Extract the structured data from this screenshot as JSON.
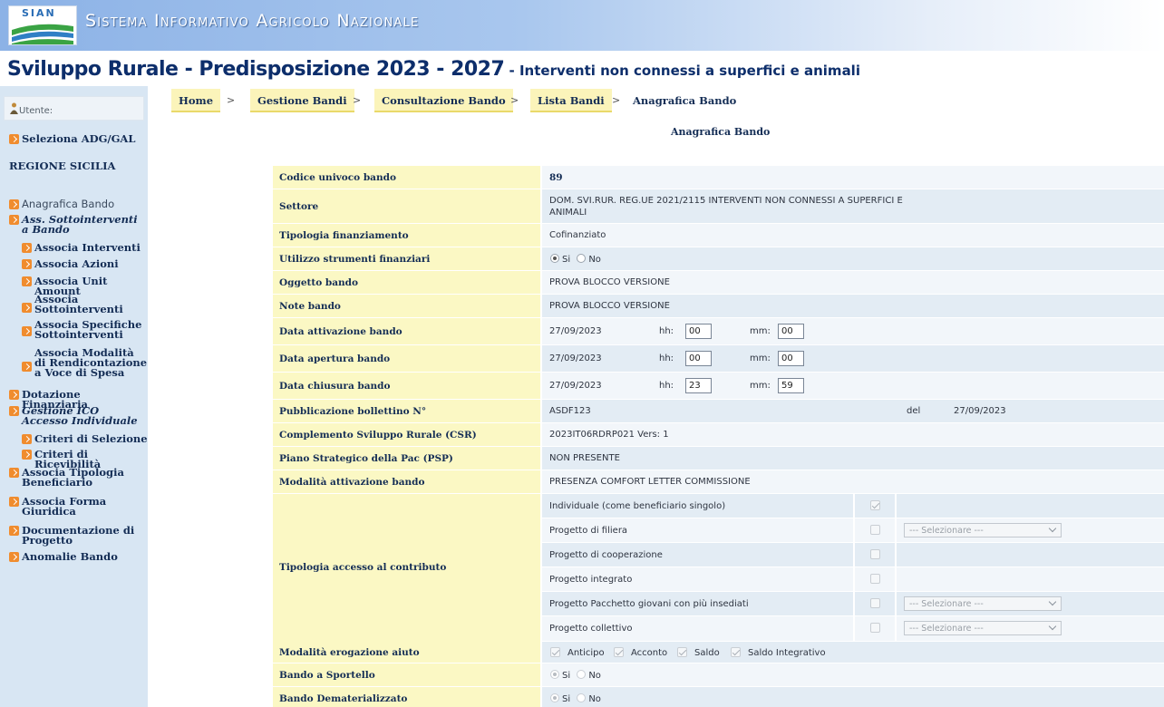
{
  "banner": {
    "logo_text": "SIAN",
    "title": "Sistema Informativo Agricolo Nazionale"
  },
  "page_title": {
    "main": "Sviluppo Rurale - Predisposizione 2023 - 2027",
    "sub": " - Interventi non connessi a superfici e animali"
  },
  "sidebar": {
    "utente_label": "Utente:",
    "seleziona": "Seleziona ADG/GAL",
    "regione": "REGIONE SICILIA",
    "items": [
      "Anagrafica Bando",
      "Ass. Sottointerventi a Bando",
      "Associa Interventi",
      "Associa Azioni",
      "Associa Unit Amount",
      "Associa Sottointerventi",
      "Associa Specifiche Sottointerventi",
      "Associa Modalità di Rendicontazione a Voce di Spesa",
      "Dotazione Finanziaria",
      "Gestione ICO Accesso Individuale",
      "Criteri di Selezione",
      "Criteri di Ricevibilità",
      "Associa Tipologia Beneficiario",
      "Associa Forma Giuridica",
      "Documentazione di Progetto",
      "Anomalie Bando"
    ]
  },
  "breadcrumb": {
    "home": "Home",
    "gestione": "Gestione Bandi",
    "consultazione": "Consultazione Bando",
    "lista": "Lista Bandi",
    "current": "Anagrafica Bando",
    "sep": ">"
  },
  "section_title": "Anagrafica Bando",
  "form": {
    "codice_label": "Codice univoco bando",
    "codice_value": "89",
    "settore_label": "Settore",
    "settore_value_1": "DOM. SVI.RUR. REG.UE 2021/2115 INTERVENTI NON CONNESSI A SUPERFICI E",
    "settore_value_2": "ANIMALI",
    "tipologia_fin_label": "Tipologia finanziamento",
    "tipologia_fin_value": "Cofinanziato",
    "utilizzo_label": "Utilizzo strumenti finanziari",
    "si": "Si",
    "no": "No",
    "oggetto_label": "Oggetto bando",
    "oggetto_value": "PROVA BLOCCO VERSIONE",
    "note_label": "Note bando",
    "note_value": "PROVA BLOCCO VERSIONE",
    "hh_label": "hh:",
    "mm_label": "mm:",
    "attivazione_label": "Data attivazione bando",
    "attivazione_date": "27/09/2023",
    "attivazione_hh": "00",
    "attivazione_mm": "00",
    "apertura_label": "Data apertura bando",
    "apertura_date": "27/09/2023",
    "apertura_hh": "00",
    "apertura_mm": "00",
    "chiusura_label": "Data chiusura bando",
    "chiusura_date": "27/09/2023",
    "chiusura_hh": "23",
    "chiusura_mm": "59",
    "bollettino_label": "Pubblicazione bollettino N°",
    "bollettino_value": "ASDF123",
    "del_label": "del",
    "del_value": "27/09/2023",
    "csr_label": "Complemento Sviluppo Rurale (CSR)",
    "csr_value": "2023IT06RDRP021 Vers: 1",
    "psp_label": "Piano Strategico della Pac (PSP)",
    "psp_value": "NON PRESENTE",
    "modalita_att_label": "Modalità attivazione bando",
    "modalita_att_value": "PRESENZA COMFORT LETTER COMMISSIONE",
    "tipologia_accesso_label": "Tipologia accesso al contributo",
    "accesso_options": [
      "Individuale (come beneficiario singolo)",
      "Progetto di filiera",
      "Progetto di cooperazione",
      "Progetto integrato",
      "Progetto Pacchetto giovani con più insediati",
      "Progetto collettivo"
    ],
    "select_placeholder": "--- Selezionare ---",
    "erogazione_label": "Modalità erogazione aiuto",
    "erogazione_options": [
      "Anticipo",
      "Acconto",
      "Saldo",
      "Saldo Integrativo"
    ],
    "sportello_label": "Bando a Sportello",
    "demat_label": "Bando Dematerializzato"
  }
}
